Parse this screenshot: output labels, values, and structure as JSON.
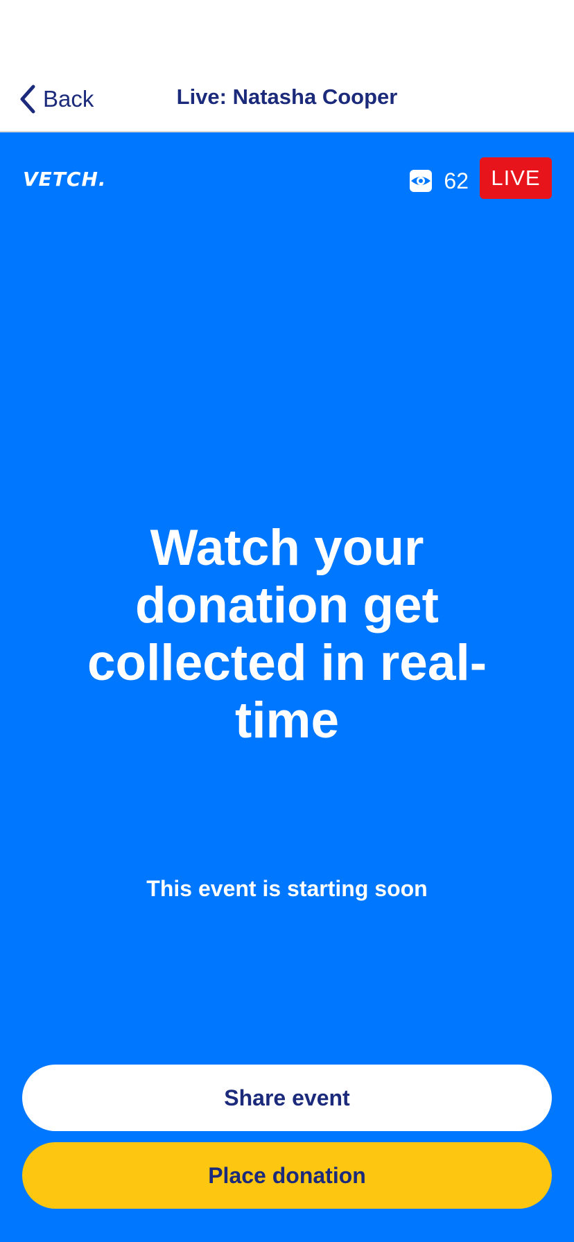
{
  "navbar": {
    "back_label": "Back",
    "title": "Live: Natasha Cooper"
  },
  "stage": {
    "logo": "VETCH.",
    "viewer_icon": "eye-icon",
    "viewer_count": "62",
    "live_badge": "LIVE",
    "headline": "Watch your donation get collected in real-time",
    "status": "This event is starting soon"
  },
  "actions": {
    "share_label": "Share event",
    "donate_label": "Place donation"
  },
  "colors": {
    "stage_background": "#0077ff",
    "navy_text": "#1b2a7a",
    "live_red": "#e8141c",
    "donate_yellow": "#fdc610"
  }
}
